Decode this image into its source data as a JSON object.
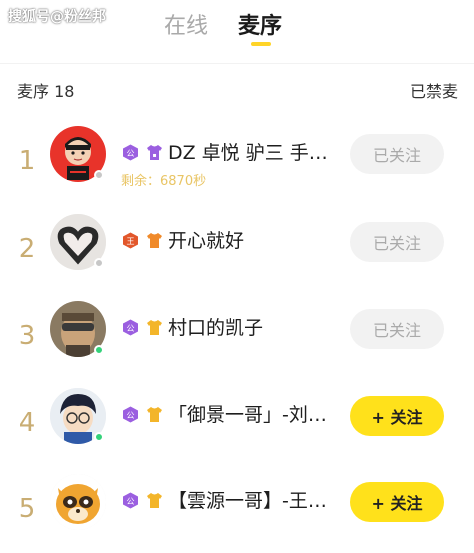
{
  "watermark": "搜狐号@粉丝邦",
  "tabs": [
    {
      "label": "在线",
      "active": false
    },
    {
      "label": "麦序",
      "active": true
    }
  ],
  "queue": {
    "header": "麦序 18",
    "ban_label": "已禁麦"
  },
  "colors": {
    "accent": "#ffd428",
    "follow_button": "#ffe11b",
    "rank_number": "#c9ad73",
    "online_dot": "#34d27a",
    "offline_dot": "#c7c7c7",
    "remaining_text": "#e9c565"
  },
  "rows": [
    {
      "rank": "1",
      "name": "DZ 卓悦 驴三 手…",
      "remaining": "剩余：6870秒",
      "button": "已关注",
      "followed": true,
      "online": false,
      "badges": [
        "vip-purple-badge",
        "tshirt-purple-icon"
      ],
      "avatar": "red-cartoon-avatar"
    },
    {
      "rank": "2",
      "name": "开心就好",
      "remaining": "",
      "button": "已关注",
      "followed": true,
      "online": false,
      "badges": [
        "king-red-badge",
        "tshirt-orange-icon"
      ],
      "avatar": "heart-hands-avatar"
    },
    {
      "rank": "3",
      "name": "村口的凯子",
      "remaining": "",
      "button": "已关注",
      "followed": true,
      "online": true,
      "badges": [
        "vip-purple-badge",
        "tshirt-yellow-icon"
      ],
      "avatar": "photo-man-avatar"
    },
    {
      "rank": "4",
      "name": "「御景一哥」-刘…",
      "remaining": "",
      "button": "+ 关注",
      "followed": false,
      "online": true,
      "badges": [
        "vip-purple-badge",
        "tshirt-yellow-icon"
      ],
      "avatar": "anime-boy-avatar"
    },
    {
      "rank": "5",
      "name": "【雲源一哥】-王…",
      "remaining": "",
      "button": "+ 关注",
      "followed": false,
      "online": false,
      "badges": [
        "vip-purple-badge",
        "tshirt-yellow-icon"
      ],
      "avatar": "raccoon-mascot-avatar"
    }
  ]
}
